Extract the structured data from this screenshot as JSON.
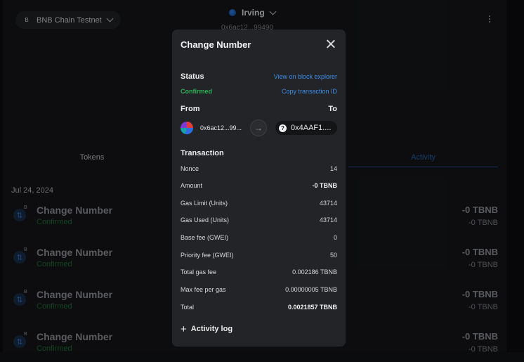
{
  "header": {
    "network_badge": "B",
    "network": "BNB Chain Testnet",
    "account_name": "Irving",
    "account_address": "0x6ac12...99490"
  },
  "tabs": {
    "tokens": "Tokens",
    "activity": "Activity"
  },
  "activity": {
    "date": "Jul 24, 2024",
    "items": [
      {
        "badge": "B",
        "title": "Change Number",
        "status": "Confirmed",
        "amount": "-0 TBNB",
        "amount_secondary": "-0 TBNB"
      },
      {
        "badge": "B",
        "title": "Change Number",
        "status": "Confirmed",
        "amount": "-0 TBNB",
        "amount_secondary": "-0 TBNB"
      },
      {
        "badge": "B",
        "title": "Change Number",
        "status": "Confirmed",
        "amount": "-0 TBNB",
        "amount_secondary": "-0 TBNB"
      },
      {
        "badge": "B",
        "title": "Change Number",
        "status": "Confirmed",
        "amount": "-0 TBNB",
        "amount_secondary": "-0 TBNB"
      }
    ]
  },
  "modal": {
    "title": "Change Number",
    "status_label": "Status",
    "status_value": "Confirmed",
    "view_explorer": "View on block explorer",
    "copy_tx": "Copy transaction ID",
    "from_label": "From",
    "to_label": "To",
    "from_address": "0x6ac12...99...",
    "to_address": "0x4AAF1....",
    "transaction_label": "Transaction",
    "rows": [
      {
        "label": "Nonce",
        "value": "14",
        "bold": false
      },
      {
        "label": "Amount",
        "value": "-0 TBNB",
        "bold": true
      },
      {
        "label": "Gas Limit (Units)",
        "value": "43714",
        "bold": false
      },
      {
        "label": "Gas Used (Units)",
        "value": "43714",
        "bold": false
      },
      {
        "label": "Base fee (GWEI)",
        "value": "0",
        "bold": false
      },
      {
        "label": "Priority fee (GWEI)",
        "value": "50",
        "bold": false
      },
      {
        "label": "Total gas fee",
        "value": "0.002186 TBNB",
        "bold": false
      },
      {
        "label": "Max fee per gas",
        "value": "0.00000005 TBNB",
        "bold": false
      },
      {
        "label": "Total",
        "value": "0.0021857 TBNB",
        "bold": true
      }
    ],
    "activity_log": "Activity log"
  },
  "colors": {
    "accent": "#3f8de8",
    "success": "#2fae55",
    "modal_bg": "#222427"
  },
  "icons": {
    "close": "close-icon",
    "arrow": "arrow-right-icon",
    "plus": "plus-icon"
  }
}
